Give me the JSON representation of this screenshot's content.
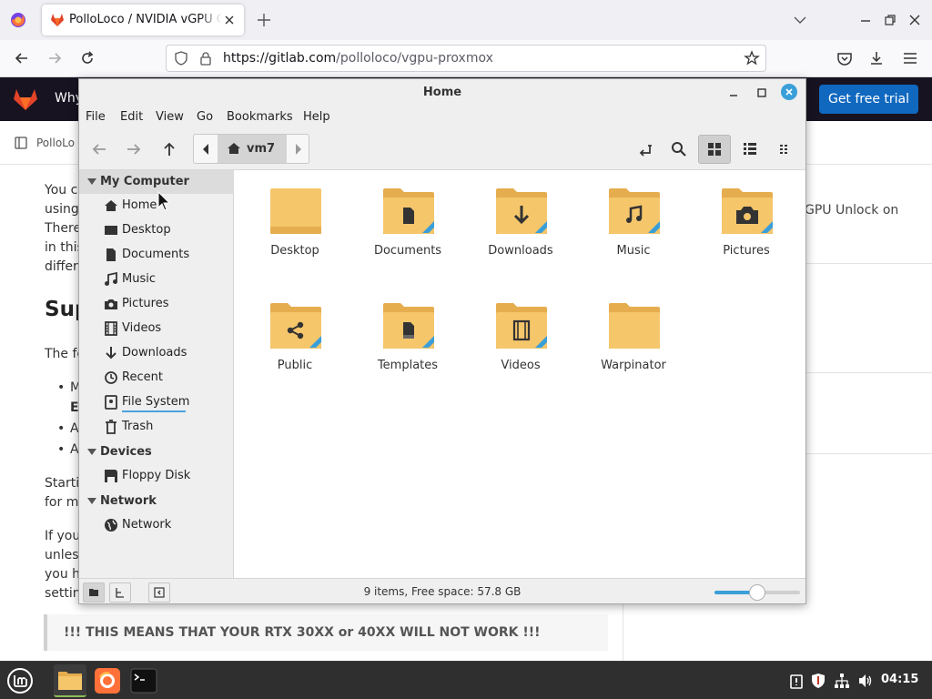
{
  "browser": {
    "tab_title": "PolloLoco / NVIDIA vGPU Gu",
    "url_domain": "https://gitlab.com",
    "url_path": "/polloloco/vgpu-proxmox"
  },
  "webpage": {
    "nav_why": "Why",
    "trial_button": "Get free trial",
    "breadcrumb": "PolloLo",
    "side_text": "GPU Unlock on",
    "left_fragments": [
      "You c",
      "using",
      "There",
      "in this",
      "differ",
      "Sup",
      "The fe",
      "M",
      "E",
      "A",
      "A",
      "Starti",
      "for m",
      "If you",
      "unles",
      "you h",
      "settin"
    ],
    "warning": "!!! THIS MEANS THAT YOUR RTX 30XX or 40XX WILL NOT WORK !!!"
  },
  "file_manager": {
    "window_title": "Home",
    "menu": [
      "File",
      "Edit",
      "View",
      "Go",
      "Bookmarks",
      "Help"
    ],
    "path_segment": "vm7",
    "sidebar": {
      "sections": [
        {
          "title": "My Computer",
          "items": [
            {
              "label": "Home",
              "icon": "home-icon"
            },
            {
              "label": "Desktop",
              "icon": "desktop-icon"
            },
            {
              "label": "Documents",
              "icon": "documents-icon"
            },
            {
              "label": "Music",
              "icon": "music-icon"
            },
            {
              "label": "Pictures",
              "icon": "camera-icon"
            },
            {
              "label": "Videos",
              "icon": "film-icon"
            },
            {
              "label": "Downloads",
              "icon": "download-icon"
            },
            {
              "label": "Recent",
              "icon": "clock-icon"
            },
            {
              "label": "File System",
              "icon": "drive-icon"
            },
            {
              "label": "Trash",
              "icon": "trash-icon"
            }
          ]
        },
        {
          "title": "Devices",
          "items": [
            {
              "label": "Floppy Disk",
              "icon": "floppy-icon"
            }
          ]
        },
        {
          "title": "Network",
          "items": [
            {
              "label": "Network",
              "icon": "globe-icon"
            }
          ]
        }
      ]
    },
    "folders": [
      {
        "label": "Desktop",
        "emblem": "none"
      },
      {
        "label": "Documents",
        "emblem": "document"
      },
      {
        "label": "Downloads",
        "emblem": "download"
      },
      {
        "label": "Music",
        "emblem": "music"
      },
      {
        "label": "Pictures",
        "emblem": "camera"
      },
      {
        "label": "Public",
        "emblem": "share"
      },
      {
        "label": "Templates",
        "emblem": "template"
      },
      {
        "label": "Videos",
        "emblem": "film"
      },
      {
        "label": "Warpinator",
        "emblem": "none"
      }
    ],
    "status": "9 items, Free space: 57.8 GB",
    "zoom_level": 0.5
  },
  "taskbar": {
    "clock": "04:15",
    "apps": [
      "mint-menu",
      "files",
      "firefox",
      "terminal"
    ]
  },
  "colors": {
    "accent": "#3a9fd9",
    "folder": "#f6c66b",
    "folder_dark": "#e6ad4f",
    "gitlab_header": "#171321",
    "gitlab_button": "#1068bf",
    "mint_green": "#8fbc5a"
  }
}
